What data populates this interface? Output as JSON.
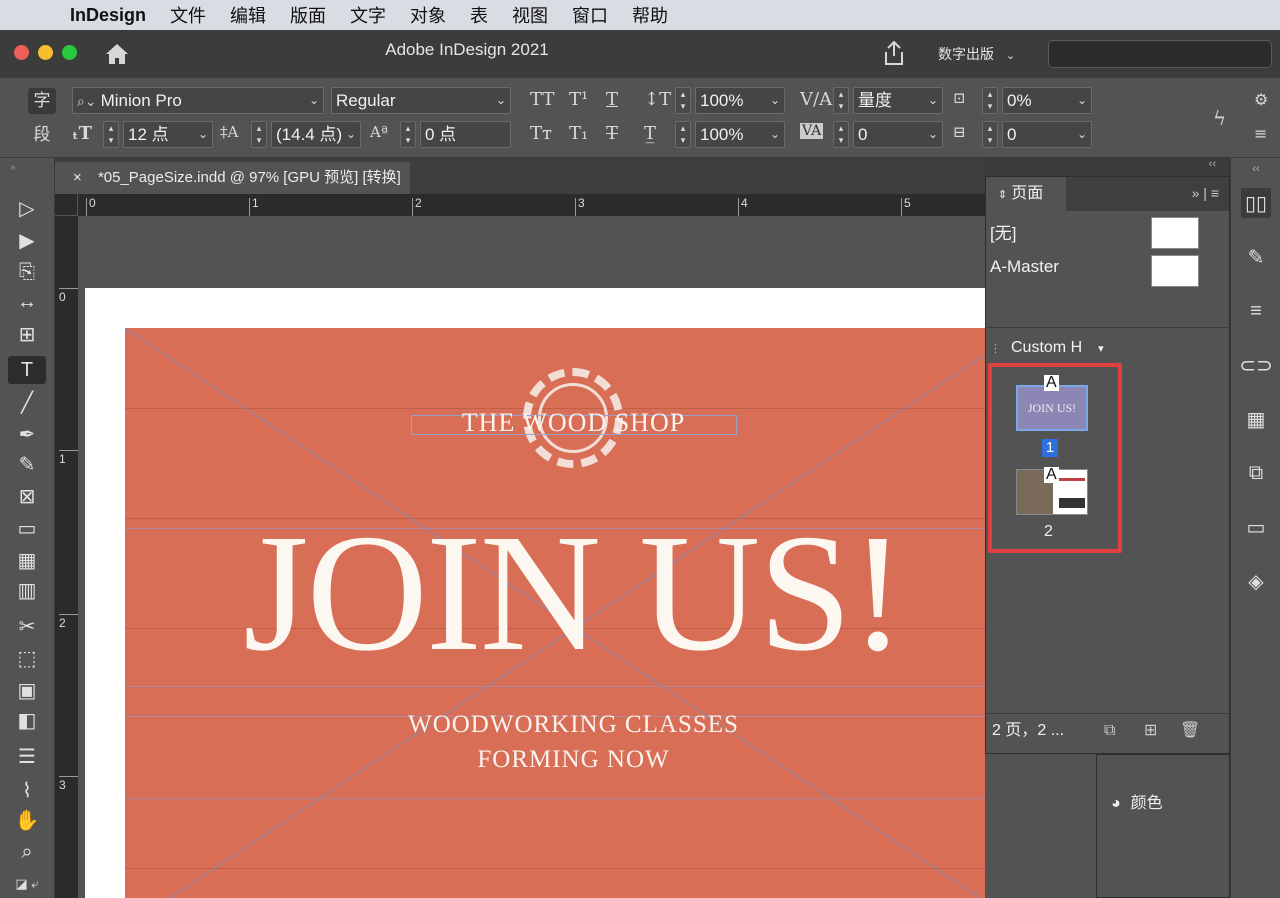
{
  "menubar": {
    "app_name": "InDesign",
    "items": [
      "文件",
      "编辑",
      "版面",
      "文字",
      "对象",
      "表",
      "视图",
      "窗口",
      "帮助"
    ]
  },
  "titlebar": {
    "title": "Adobe InDesign 2021",
    "publish_label": "数字出版",
    "search_placeholder": ""
  },
  "control": {
    "mode_char": "字",
    "mode_para": "段",
    "font_family": "Minion Pro",
    "font_style": "Regular",
    "font_size": "12 点",
    "leading": "(14.4 点)",
    "baseline_shift": "0 点",
    "vertical_scale": "100%",
    "horizontal_scale": "100%",
    "kerning": "量度",
    "tracking": "0",
    "skew": "0%",
    "char_rotation": "0"
  },
  "document_tab": {
    "close": "×",
    "label": "*05_PageSize.indd @ 97% [GPU 预览] [转换]"
  },
  "rulers": {
    "horizontal": [
      "0",
      "1",
      "2",
      "3",
      "4",
      "5"
    ],
    "vertical": [
      "0",
      "1",
      "2",
      "3"
    ]
  },
  "artwork": {
    "logo_text": "THE WOOD SHOP",
    "headline": "JOIN US!",
    "sub_line1": "WOODWORKING CLASSES",
    "sub_line2": "FORMING NOW",
    "background_color": "#d86e55"
  },
  "pages_panel": {
    "tab_label": "页面",
    "masters": [
      {
        "label": "[无]"
      },
      {
        "label": "A-Master"
      }
    ],
    "page_size_label": "Custom H",
    "page1_thumb_text": "JOIN US!",
    "page1_master_letter": "A",
    "page1_number": "1",
    "page2_master_letter": "A",
    "page2_number": "2",
    "footer_status": "2 页，2 ...",
    "highlight_color": "#e04040"
  },
  "color_panel": {
    "label": "颜色"
  }
}
